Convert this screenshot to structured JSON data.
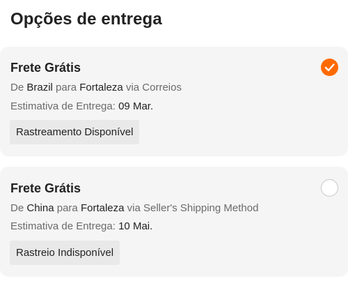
{
  "page": {
    "title": "Opções de entrega"
  },
  "accent_color": "#ff6a00",
  "options": [
    {
      "name": "Frete Grátis",
      "from_prefix": "De",
      "origin": "Brazil",
      "to_prefix": "para",
      "destination": "Fortaleza",
      "via_text": "via Correios",
      "estimate_label": "Estimativa de Entrega:",
      "estimate_value": "09 Mar.",
      "tracking": "Rastreamento Disponível",
      "selected": true,
      "selector_icon": "check-circle-icon"
    },
    {
      "name": "Frete Grátis",
      "from_prefix": "De",
      "origin": "China",
      "to_prefix": "para",
      "destination": "Fortaleza",
      "via_text": "via Seller's Shipping Method",
      "estimate_label": "Estimativa de Entrega:",
      "estimate_value": "10 Mai.",
      "tracking": "Rastreio Indisponível",
      "selected": false,
      "selector_icon": "empty-circle-icon"
    }
  ]
}
